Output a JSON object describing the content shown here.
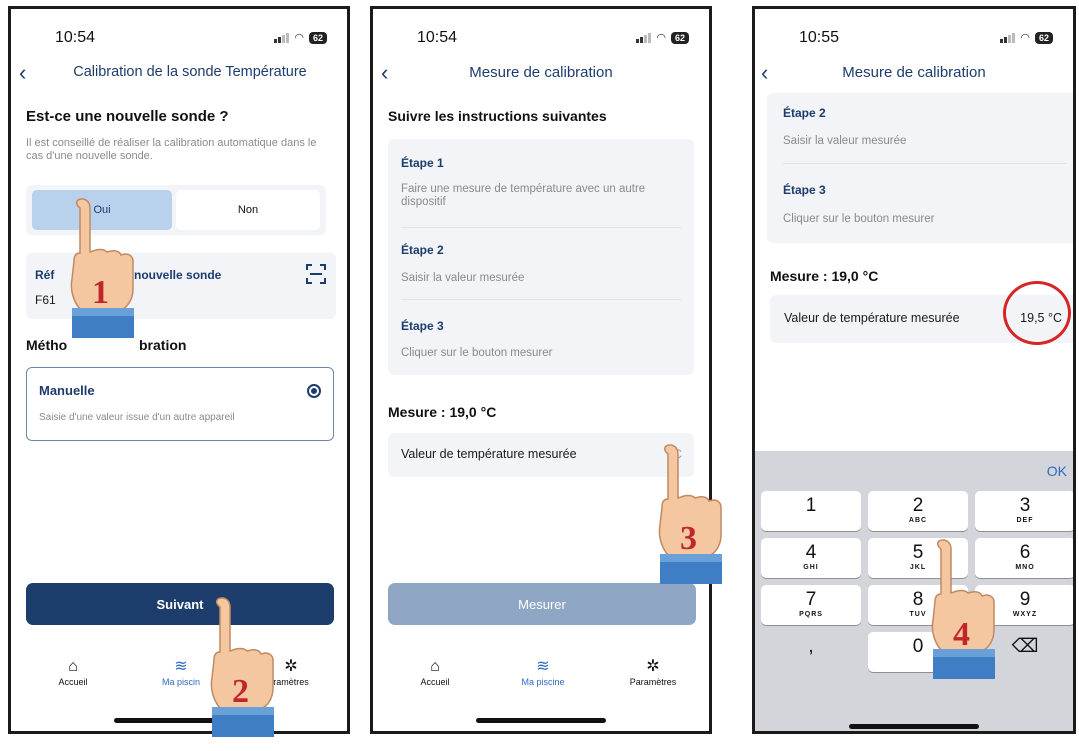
{
  "status": {
    "time1": "10:54",
    "time2": "10:54",
    "time3": "10:55",
    "battery": "62"
  },
  "screen1": {
    "nav_title": "Calibration de la sonde Température",
    "question": "Est-ce une nouvelle sonde ?",
    "hint": "Il est conseillé de réaliser la calibration automatique dans le cas d'une nouvelle sonde.",
    "seg_yes": "Oui",
    "seg_no": "Non",
    "ref_label_a": "Réf",
    "ref_label_b": "nouvelle sonde",
    "ref_value": "F61",
    "method_a": "Métho",
    "method_b": "bration",
    "method_name": "Manuelle",
    "method_desc": "Saisie d'une valeur issue d'un autre appareil",
    "next_button": "Suivant",
    "tabs": [
      {
        "label": "Accueil",
        "icon": "home-icon"
      },
      {
        "label": "Ma piscine",
        "icon": "pool-icon"
      },
      {
        "label": "Paramètres",
        "icon": "gear-icon"
      }
    ],
    "tab_mid_visible": "Ma piscin",
    "tab_right_visible": "ramètres"
  },
  "screen2": {
    "nav_title": "Mesure de calibration",
    "heading": "Suivre les instructions suivantes",
    "steps": [
      {
        "title": "Étape 1",
        "text": "Faire une mesure de température avec un autre dispositif"
      },
      {
        "title": "Étape 2",
        "text": "Saisir la valeur mesurée"
      },
      {
        "title": "Étape 3",
        "text": "Cliquer sur le bouton mesurer"
      }
    ],
    "measure": "Mesure : 19,0 °C",
    "field_label": "Valeur de température mesurée",
    "field_unit": "C",
    "measure_button": "Mesurer",
    "tabs": [
      {
        "label": "Accueil"
      },
      {
        "label": "Ma piscine"
      },
      {
        "label": "Paramètres"
      }
    ]
  },
  "screen3": {
    "nav_title": "Mesure de calibration",
    "steps": [
      {
        "title": "Étape 2",
        "text": "Saisir la valeur mesurée"
      },
      {
        "title": "Étape 3",
        "text": "Cliquer sur le bouton mesurer"
      }
    ],
    "measure": "Mesure : 19,0 °C",
    "field_label": "Valeur de température mesurée",
    "field_value": "19,5 °C",
    "ok": "OK",
    "keys": [
      {
        "d": "1",
        "s": ""
      },
      {
        "d": "2",
        "s": "ABC"
      },
      {
        "d": "3",
        "s": "DEF"
      },
      {
        "d": "4",
        "s": "GHI"
      },
      {
        "d": "5",
        "s": "JKL"
      },
      {
        "d": "6",
        "s": "MNO"
      },
      {
        "d": "7",
        "s": "PQRS"
      },
      {
        "d": "8",
        "s": "TUV"
      },
      {
        "d": "9",
        "s": "WXYZ"
      },
      {
        "d": ",",
        "s": ""
      },
      {
        "d": "0",
        "s": ""
      },
      {
        "d": "⌫",
        "s": ""
      }
    ]
  },
  "annotations": {
    "n1": "1",
    "n2": "2",
    "n3": "3",
    "n4": "4"
  },
  "colors": {
    "brand": "#1c3c6e",
    "accent": "#2d6bc2",
    "highlight": "#d62525",
    "step_number": "#c0272d"
  }
}
